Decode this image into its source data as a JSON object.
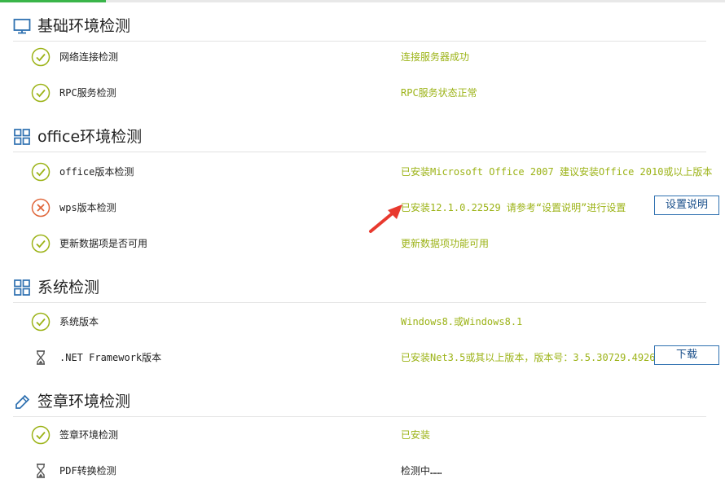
{
  "colors": {
    "progress": "#3ab54a",
    "ok": "#9cb317",
    "error": "#e0663a",
    "accent": "#2e70b0",
    "arrow": "#e8392e"
  },
  "sections": [
    {
      "title": "基础环境检测",
      "icon": "monitor-icon",
      "rows": [
        {
          "status": "check-icon",
          "name": "网络连接检测",
          "result": "连接服务器成功"
        },
        {
          "status": "check-icon",
          "name": "RPC服务检测",
          "result": "RPC服务状态正常"
        }
      ]
    },
    {
      "title": "office环境检测",
      "icon": "grid-icon",
      "rows": [
        {
          "status": "check-icon",
          "name": "office版本检测",
          "result": "已安装Microsoft Office 2007 建议安装Office 2010或以上版本"
        },
        {
          "status": "error-icon",
          "name": "wps版本检测",
          "result": "已安装12.1.0.22529 请参考“设置说明”进行设置",
          "button": "设置说明"
        },
        {
          "status": "check-icon",
          "name": "更新数据项是否可用",
          "result": "更新数据项功能可用"
        }
      ]
    },
    {
      "title": "系统检测",
      "icon": "grid-icon",
      "rows": [
        {
          "status": "check-icon",
          "name": "系统版本",
          "result": "Windows8.或Windows8.1"
        },
        {
          "status": "hourglass-icon",
          "name": ".NET Framework版本",
          "result": "已安装Net3.5或其以上版本，版本号：3.5.30729.4926",
          "button": "下载"
        }
      ]
    },
    {
      "title": "签章环境检测",
      "icon": "pen-icon",
      "rows": [
        {
          "status": "check-icon",
          "name": "签章环境检测",
          "result": "已安装"
        },
        {
          "status": "hourglass-icon",
          "name": "PDF转换检测",
          "result": "检测中……"
        }
      ]
    }
  ]
}
